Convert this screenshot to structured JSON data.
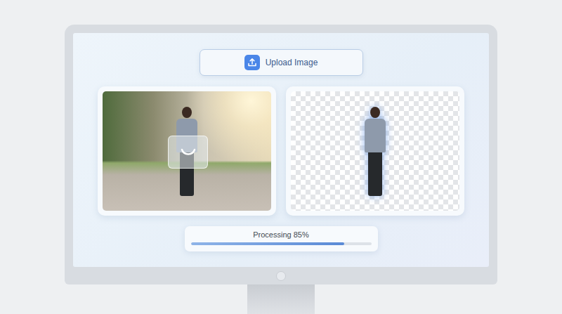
{
  "upload_button": {
    "label": "Upload Image"
  },
  "original_image": {
    "loading": true
  },
  "progress": {
    "label": "Processing 85%",
    "level": 0.85
  }
}
